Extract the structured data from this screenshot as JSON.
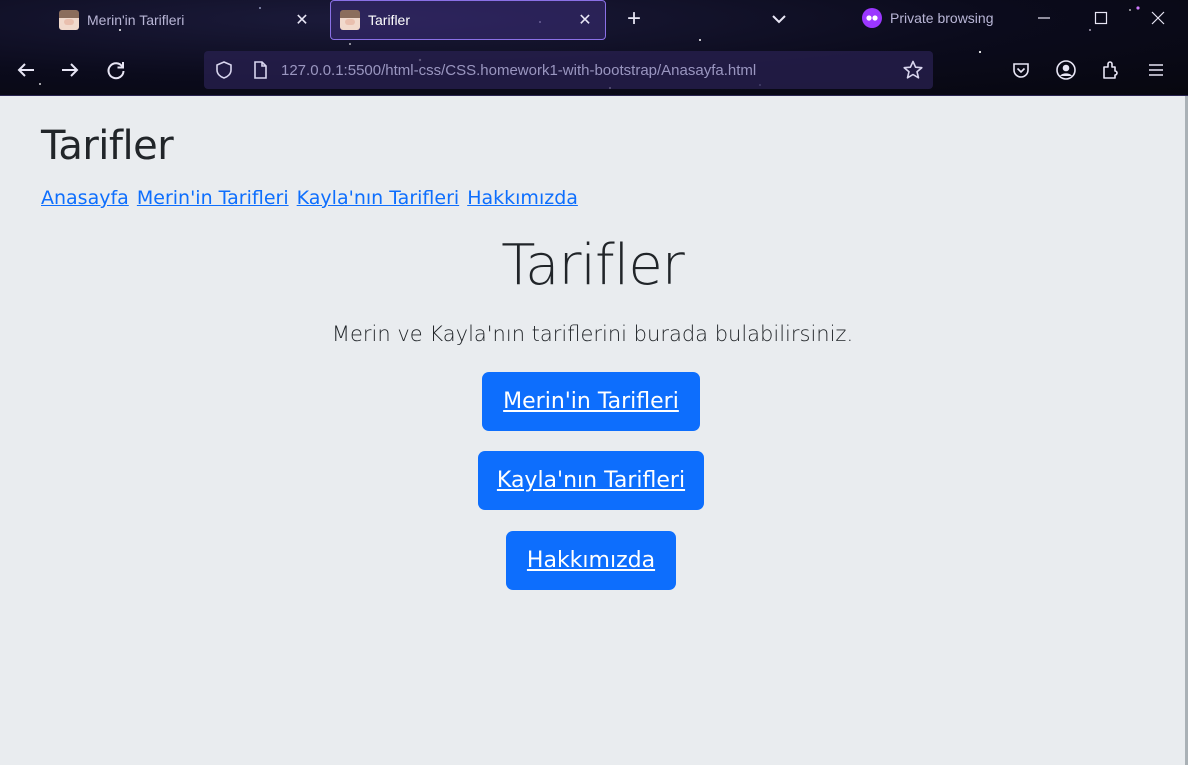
{
  "browser": {
    "tabs": [
      {
        "title": "Merin'in Tarifleri",
        "active": false
      },
      {
        "title": "Tarifler",
        "active": true
      }
    ],
    "private_label": "Private browsing",
    "url": "127.0.0.1:5500/html-css/CSS.homework1-with-bootstrap/Anasayfa.html",
    "accent_color": "#8a70e6",
    "private_color": "#9b37ff",
    "icons": [
      "back-icon",
      "forward-icon",
      "reload-icon",
      "shield-icon",
      "page-icon",
      "star-icon",
      "pocket-icon",
      "account-icon",
      "extensions-icon",
      "menu-icon",
      "minimize-icon",
      "maximize-icon",
      "close-icon",
      "new-tab-icon",
      "list-tabs-icon",
      "private-mask-icon"
    ]
  },
  "site": {
    "brand": "Tarifler",
    "nav": [
      "Anasayfa",
      "Merin'in Tarifleri",
      "Kayla'nın Tarifleri",
      "Hakkımızda"
    ],
    "hero_title": "Tarifler",
    "hero_lead": "Merin ve Kayla'nın tariflerini burada bulabilirsiniz.",
    "buttons": [
      "Merin'in Tarifleri",
      "Kayla'nın Tarifleri",
      "Hakkımızda"
    ],
    "link_color": "#0d6efd",
    "button_color": "#0d6efd",
    "background_color": "#e9ecef"
  }
}
